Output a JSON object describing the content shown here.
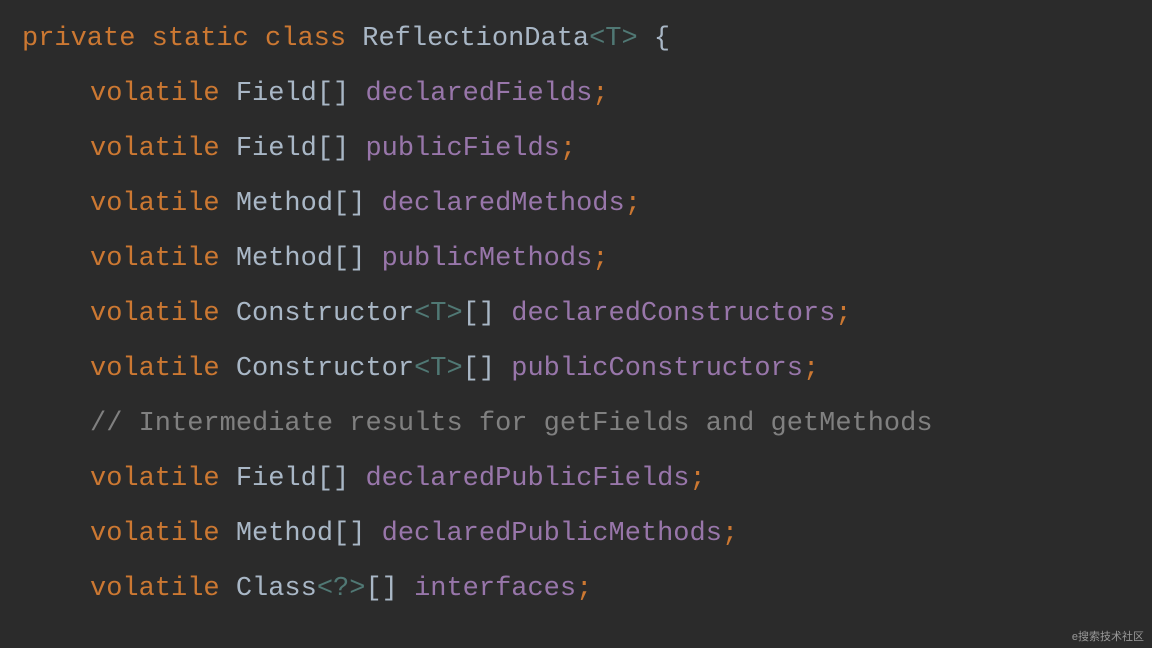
{
  "line0": {
    "kw1": "private",
    "kw2": "static",
    "kw3": "class",
    "classname": "ReflectionData",
    "generic": "<T>",
    "brace": "{"
  },
  "line1": {
    "kw": "volatile",
    "type": "Field",
    "brackets": "[]",
    "ident": "declaredFields",
    "semi": ";"
  },
  "line2": {
    "kw": "volatile",
    "type": "Field",
    "brackets": "[]",
    "ident": "publicFields",
    "semi": ";"
  },
  "line3": {
    "kw": "volatile",
    "type": "Method",
    "brackets": "[]",
    "ident": "declaredMethods",
    "semi": ";"
  },
  "line4": {
    "kw": "volatile",
    "type": "Method",
    "brackets": "[]",
    "ident": "publicMethods",
    "semi": ";"
  },
  "line5": {
    "kw": "volatile",
    "type": "Constructor",
    "generic": "<T>",
    "brackets": "[]",
    "ident": "declaredConstructors",
    "semi": ";"
  },
  "line6": {
    "kw": "volatile",
    "type": "Constructor",
    "generic": "<T>",
    "brackets": "[]",
    "ident": "publicConstructors",
    "semi": ";"
  },
  "line7": {
    "comment": "// Intermediate results for getFields and getMethods"
  },
  "line8": {
    "kw": "volatile",
    "type": "Field",
    "brackets": "[]",
    "ident": "declaredPublicFields",
    "semi": ";"
  },
  "line9": {
    "kw": "volatile",
    "type": "Method",
    "brackets": "[]",
    "ident": "declaredPublicMethods",
    "semi": ";"
  },
  "line10": {
    "kw": "volatile",
    "type": "Class",
    "generic": "<?>",
    "brackets": "[]",
    "ident": "interfaces",
    "semi": ";"
  },
  "watermark": "e搜索技术社区"
}
